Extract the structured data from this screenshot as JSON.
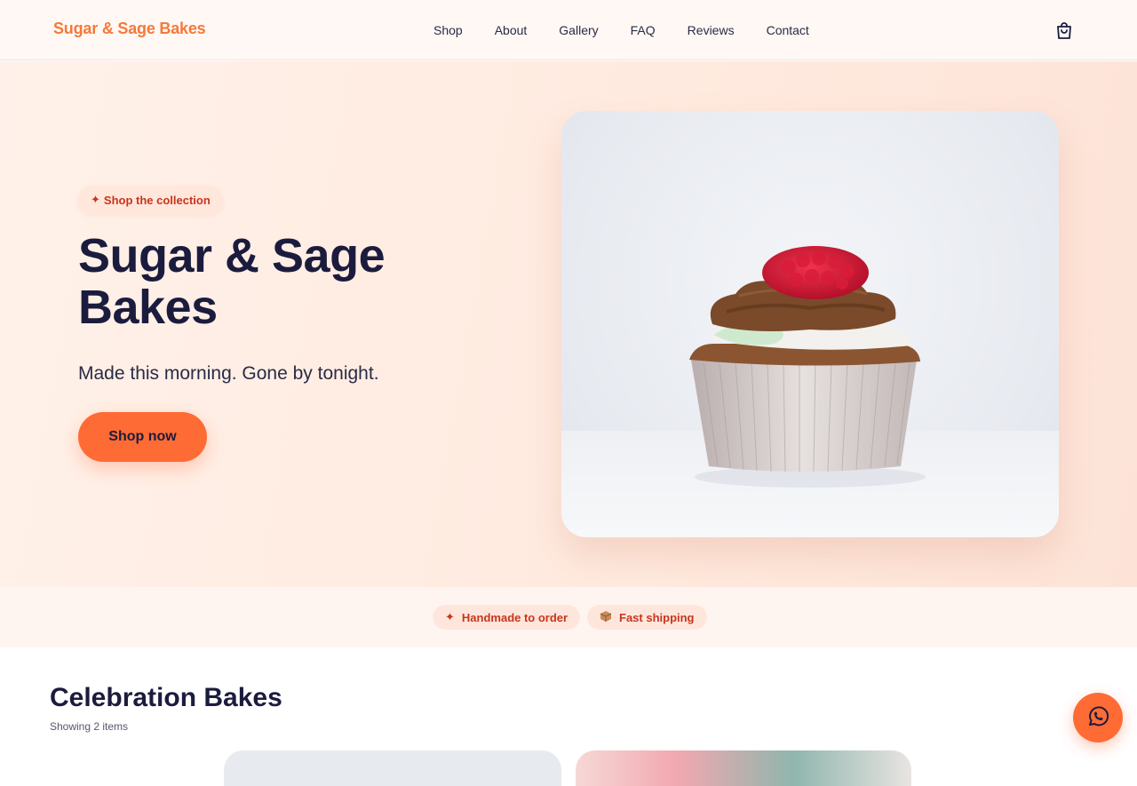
{
  "brand": {
    "name": "Sugar & Sage Bakes"
  },
  "nav": {
    "items": [
      "Shop",
      "About",
      "Gallery",
      "FAQ",
      "Reviews",
      "Contact"
    ]
  },
  "icons": {
    "cart": "shopping-bag-icon",
    "sparkle": "sparkle-icon",
    "box": "package-icon",
    "chat": "whatsapp-icon"
  },
  "hero": {
    "badge": "Shop the collection",
    "title": "Sugar & Sage Bakes",
    "subtitle": "Made this morning. Gone by tonight.",
    "cta": "Shop now"
  },
  "features": [
    "Handmade to order",
    "Fast shipping"
  ],
  "section": {
    "title": "Celebration Bakes",
    "count": "Showing 2 items"
  },
  "colors": {
    "accent": "#ff6b35",
    "brand": "#f5793a",
    "badge_text": "#c8351b",
    "heading": "#1b1c3d"
  }
}
